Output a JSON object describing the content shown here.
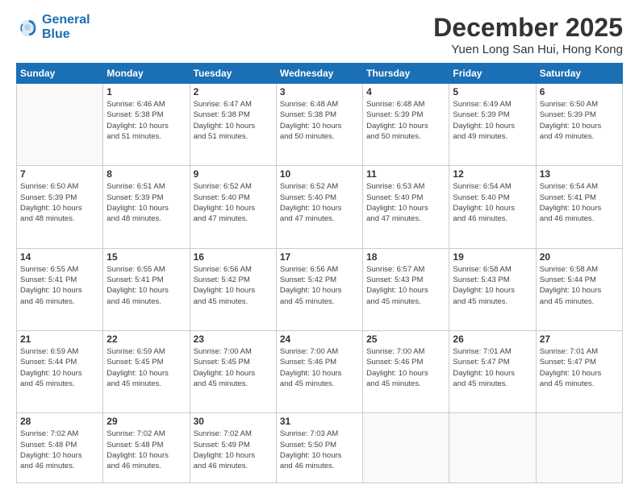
{
  "header": {
    "logo_line1": "General",
    "logo_line2": "Blue",
    "month_title": "December 2025",
    "location": "Yuen Long San Hui, Hong Kong"
  },
  "weekdays": [
    "Sunday",
    "Monday",
    "Tuesday",
    "Wednesday",
    "Thursday",
    "Friday",
    "Saturday"
  ],
  "weeks": [
    [
      {
        "day": "",
        "info": ""
      },
      {
        "day": "1",
        "info": "Sunrise: 6:46 AM\nSunset: 5:38 PM\nDaylight: 10 hours\nand 51 minutes."
      },
      {
        "day": "2",
        "info": "Sunrise: 6:47 AM\nSunset: 5:38 PM\nDaylight: 10 hours\nand 51 minutes."
      },
      {
        "day": "3",
        "info": "Sunrise: 6:48 AM\nSunset: 5:38 PM\nDaylight: 10 hours\nand 50 minutes."
      },
      {
        "day": "4",
        "info": "Sunrise: 6:48 AM\nSunset: 5:39 PM\nDaylight: 10 hours\nand 50 minutes."
      },
      {
        "day": "5",
        "info": "Sunrise: 6:49 AM\nSunset: 5:39 PM\nDaylight: 10 hours\nand 49 minutes."
      },
      {
        "day": "6",
        "info": "Sunrise: 6:50 AM\nSunset: 5:39 PM\nDaylight: 10 hours\nand 49 minutes."
      }
    ],
    [
      {
        "day": "7",
        "info": "Sunrise: 6:50 AM\nSunset: 5:39 PM\nDaylight: 10 hours\nand 48 minutes."
      },
      {
        "day": "8",
        "info": "Sunrise: 6:51 AM\nSunset: 5:39 PM\nDaylight: 10 hours\nand 48 minutes."
      },
      {
        "day": "9",
        "info": "Sunrise: 6:52 AM\nSunset: 5:40 PM\nDaylight: 10 hours\nand 47 minutes."
      },
      {
        "day": "10",
        "info": "Sunrise: 6:52 AM\nSunset: 5:40 PM\nDaylight: 10 hours\nand 47 minutes."
      },
      {
        "day": "11",
        "info": "Sunrise: 6:53 AM\nSunset: 5:40 PM\nDaylight: 10 hours\nand 47 minutes."
      },
      {
        "day": "12",
        "info": "Sunrise: 6:54 AM\nSunset: 5:40 PM\nDaylight: 10 hours\nand 46 minutes."
      },
      {
        "day": "13",
        "info": "Sunrise: 6:54 AM\nSunset: 5:41 PM\nDaylight: 10 hours\nand 46 minutes."
      }
    ],
    [
      {
        "day": "14",
        "info": "Sunrise: 6:55 AM\nSunset: 5:41 PM\nDaylight: 10 hours\nand 46 minutes."
      },
      {
        "day": "15",
        "info": "Sunrise: 6:55 AM\nSunset: 5:41 PM\nDaylight: 10 hours\nand 46 minutes."
      },
      {
        "day": "16",
        "info": "Sunrise: 6:56 AM\nSunset: 5:42 PM\nDaylight: 10 hours\nand 45 minutes."
      },
      {
        "day": "17",
        "info": "Sunrise: 6:56 AM\nSunset: 5:42 PM\nDaylight: 10 hours\nand 45 minutes."
      },
      {
        "day": "18",
        "info": "Sunrise: 6:57 AM\nSunset: 5:43 PM\nDaylight: 10 hours\nand 45 minutes."
      },
      {
        "day": "19",
        "info": "Sunrise: 6:58 AM\nSunset: 5:43 PM\nDaylight: 10 hours\nand 45 minutes."
      },
      {
        "day": "20",
        "info": "Sunrise: 6:58 AM\nSunset: 5:44 PM\nDaylight: 10 hours\nand 45 minutes."
      }
    ],
    [
      {
        "day": "21",
        "info": "Sunrise: 6:59 AM\nSunset: 5:44 PM\nDaylight: 10 hours\nand 45 minutes."
      },
      {
        "day": "22",
        "info": "Sunrise: 6:59 AM\nSunset: 5:45 PM\nDaylight: 10 hours\nand 45 minutes."
      },
      {
        "day": "23",
        "info": "Sunrise: 7:00 AM\nSunset: 5:45 PM\nDaylight: 10 hours\nand 45 minutes."
      },
      {
        "day": "24",
        "info": "Sunrise: 7:00 AM\nSunset: 5:46 PM\nDaylight: 10 hours\nand 45 minutes."
      },
      {
        "day": "25",
        "info": "Sunrise: 7:00 AM\nSunset: 5:46 PM\nDaylight: 10 hours\nand 45 minutes."
      },
      {
        "day": "26",
        "info": "Sunrise: 7:01 AM\nSunset: 5:47 PM\nDaylight: 10 hours\nand 45 minutes."
      },
      {
        "day": "27",
        "info": "Sunrise: 7:01 AM\nSunset: 5:47 PM\nDaylight: 10 hours\nand 45 minutes."
      }
    ],
    [
      {
        "day": "28",
        "info": "Sunrise: 7:02 AM\nSunset: 5:48 PM\nDaylight: 10 hours\nand 46 minutes."
      },
      {
        "day": "29",
        "info": "Sunrise: 7:02 AM\nSunset: 5:48 PM\nDaylight: 10 hours\nand 46 minutes."
      },
      {
        "day": "30",
        "info": "Sunrise: 7:02 AM\nSunset: 5:49 PM\nDaylight: 10 hours\nand 46 minutes."
      },
      {
        "day": "31",
        "info": "Sunrise: 7:03 AM\nSunset: 5:50 PM\nDaylight: 10 hours\nand 46 minutes."
      },
      {
        "day": "",
        "info": ""
      },
      {
        "day": "",
        "info": ""
      },
      {
        "day": "",
        "info": ""
      }
    ]
  ]
}
